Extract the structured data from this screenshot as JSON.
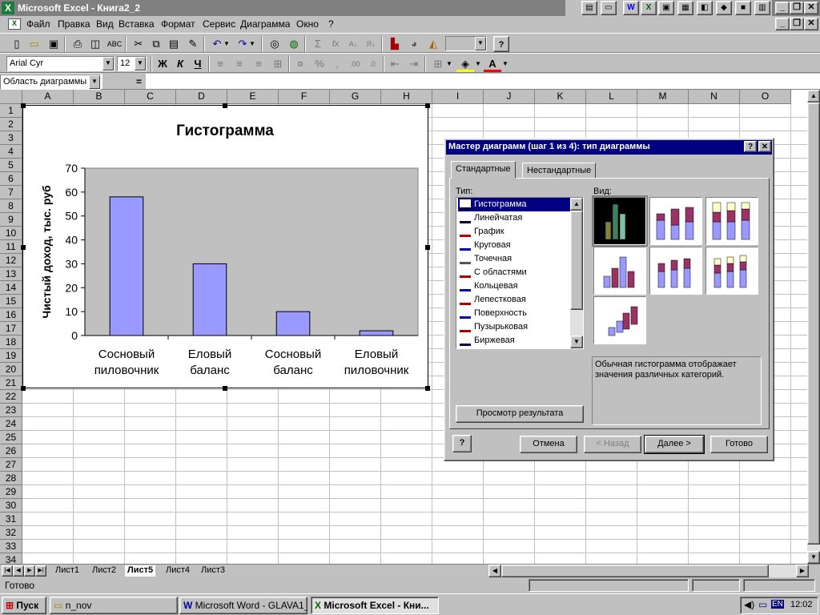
{
  "app": {
    "title": "Microsoft Excel - Книга2_2"
  },
  "menu": [
    "Файл",
    "Правка",
    "Вид",
    "Вставка",
    "Формат",
    "Сервис",
    "Диаграмма",
    "Окно",
    "?"
  ],
  "format": {
    "font": "Arial Cyr",
    "size": "12",
    "bold": "Ж",
    "italic": "К",
    "underline": "Ч",
    "percent": "%",
    "comma": ","
  },
  "formula_bar": {
    "name_box": "Область диаграммы",
    "equals": "="
  },
  "columns": [
    "A",
    "B",
    "C",
    "D",
    "E",
    "F",
    "G",
    "H",
    "I",
    "J",
    "K",
    "L",
    "M",
    "N",
    "O"
  ],
  "rows": [
    "1",
    "2",
    "3",
    "4",
    "5",
    "6",
    "7",
    "8",
    "9",
    "10",
    "11",
    "12",
    "13",
    "14",
    "15",
    "16",
    "17",
    "18",
    "19",
    "20",
    "21",
    "22",
    "23",
    "24",
    "25",
    "26",
    "27",
    "28",
    "29",
    "30",
    "31",
    "32",
    "33",
    "34"
  ],
  "chart_data": {
    "type": "bar",
    "title": "Гистограмма",
    "ylabel": "Чистый доход, тыс. руб",
    "xlabel": "",
    "categories": [
      [
        "Сосновый",
        "пиловочник"
      ],
      [
        "Еловый",
        "баланс"
      ],
      [
        "Сосновый",
        "баланс"
      ],
      [
        "Еловый",
        "пиловочник"
      ]
    ],
    "values": [
      58,
      30,
      10,
      2
    ],
    "ylim": [
      0,
      70
    ],
    "yticks": [
      "0",
      "10",
      "20",
      "30",
      "40",
      "50",
      "60",
      "70"
    ],
    "bar_color": "#9999ff",
    "plot_bg": "#c0c0c0",
    "grid": false
  },
  "sheets": [
    "Лист1",
    "Лист2",
    "Лист5",
    "Лист4",
    "Лист3"
  ],
  "active_sheet": "Лист5",
  "status": "Готово",
  "dialog": {
    "title": "Мастер диаграмм (шаг 1 из 4): тип диаграммы",
    "help": "?",
    "close": "✕",
    "tabs": [
      "Стандартные",
      "Нестандартные"
    ],
    "type_label": "Тип:",
    "view_label": "Вид:",
    "types": [
      "Гистограмма",
      "Линейчатая",
      "График",
      "Круговая",
      "Точечная",
      "С областями",
      "Кольцевая",
      "Лепестковая",
      "Поверхность",
      "Пузырьковая",
      "Биржевая"
    ],
    "description": "Обычная гистограмма отображает значения различных категорий.",
    "preview_button": "Просмотр результата",
    "buttons": {
      "cancel": "Отмена",
      "back": "< Назад",
      "next": "Далее >",
      "finish": "Готово"
    }
  },
  "taskbar": {
    "start": "Пуск",
    "tasks": [
      "n_nov",
      "Microsoft Word - GLAVA1_2",
      "Microsoft Excel - Кни..."
    ],
    "lang": "EN",
    "clock": "12:02"
  }
}
